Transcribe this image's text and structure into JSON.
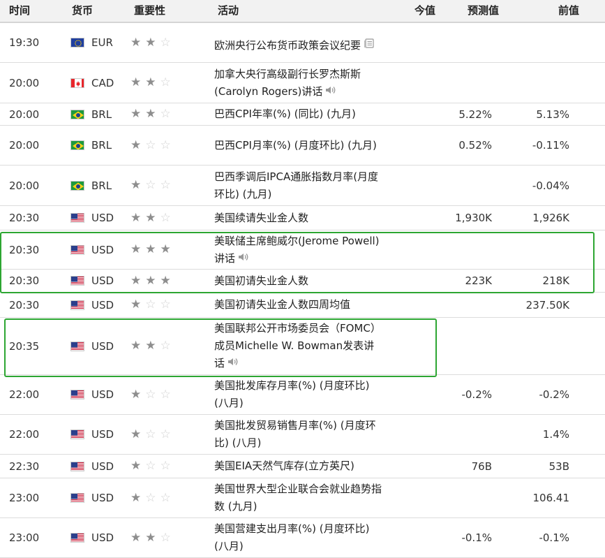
{
  "header": {
    "time": "时间",
    "currency": "货币",
    "importance": "重要性",
    "event": "活动",
    "actual": "今值",
    "forecast": "预测值",
    "previous": "前值"
  },
  "rows": [
    {
      "time": "19:30",
      "currency": "EUR",
      "flag": "eu",
      "stars": 2,
      "event": "欧洲央行公布货币政策会议纪要",
      "icon": "document-icon",
      "actual": "",
      "forecast": "",
      "previous": ""
    },
    {
      "time": "20:00",
      "currency": "CAD",
      "flag": "ca",
      "stars": 2,
      "event": "加拿大央行高级副行长罗杰斯斯(Carolyn Rogers)讲话",
      "icon": "speaker-icon",
      "actual": "",
      "forecast": "",
      "previous": ""
    },
    {
      "time": "20:00",
      "currency": "BRL",
      "flag": "br",
      "stars": 2,
      "event": "巴西CPI年率(%) (同比) (九月)",
      "icon": "",
      "actual": "",
      "forecast": "5.22%",
      "previous": "5.13%"
    },
    {
      "time": "20:00",
      "currency": "BRL",
      "flag": "br",
      "stars": 1,
      "event": "巴西CPI月率(%) (月度环比) (九月)",
      "icon": "",
      "actual": "",
      "forecast": "0.52%",
      "previous": "-0.11%"
    },
    {
      "time": "20:00",
      "currency": "BRL",
      "flag": "br",
      "stars": 1,
      "event": "巴西季调后IPCA通胀指数月率(月度环比) (九月)",
      "icon": "",
      "actual": "",
      "forecast": "",
      "previous": "-0.04%"
    },
    {
      "time": "20:30",
      "currency": "USD",
      "flag": "us",
      "stars": 2,
      "event": "美国续请失业金人数",
      "icon": "",
      "actual": "",
      "forecast": "1,930K",
      "previous": "1,926K"
    },
    {
      "time": "20:30",
      "currency": "USD",
      "flag": "us",
      "stars": 3,
      "event": "美联储主席鲍威尔(Jerome Powell)讲话",
      "icon": "speaker-icon",
      "actual": "",
      "forecast": "",
      "previous": ""
    },
    {
      "time": "20:30",
      "currency": "USD",
      "flag": "us",
      "stars": 3,
      "event": "美国初请失业金人数",
      "icon": "",
      "actual": "",
      "forecast": "223K",
      "previous": "218K"
    },
    {
      "time": "20:30",
      "currency": "USD",
      "flag": "us",
      "stars": 1,
      "event": "美国初请失业金人数四周均值",
      "icon": "",
      "actual": "",
      "forecast": "",
      "previous": "237.50K"
    },
    {
      "time": "20:35",
      "currency": "USD",
      "flag": "us",
      "stars": 2,
      "event": "美国联邦公开市场委员会（FOMC）成员Michelle W. Bowman发表讲话",
      "icon": "speaker-icon",
      "actual": "",
      "forecast": "",
      "previous": ""
    },
    {
      "time": "22:00",
      "currency": "USD",
      "flag": "us",
      "stars": 1,
      "event": "美国批发库存月率(%) (月度环比) (八月)",
      "icon": "",
      "actual": "",
      "forecast": "-0.2%",
      "previous": "-0.2%"
    },
    {
      "time": "22:00",
      "currency": "USD",
      "flag": "us",
      "stars": 1,
      "event": "美国批发贸易销售月率(%) (月度环比) (八月)",
      "icon": "",
      "actual": "",
      "forecast": "",
      "previous": "1.4%"
    },
    {
      "time": "22:30",
      "currency": "USD",
      "flag": "us",
      "stars": 1,
      "event": "美国EIA天然气库存(立方英尺)",
      "icon": "",
      "actual": "",
      "forecast": "76B",
      "previous": "53B"
    },
    {
      "time": "23:00",
      "currency": "USD",
      "flag": "us",
      "stars": 1,
      "event": "美国世界大型企业联合会就业趋势指数 (九月)",
      "icon": "",
      "actual": "",
      "forecast": "",
      "previous": "106.41"
    },
    {
      "time": "23:00",
      "currency": "USD",
      "flag": "us",
      "stars": 2,
      "event": "美国营建支出月率(%) (月度环比) (八月)",
      "icon": "",
      "actual": "",
      "forecast": "-0.1%",
      "previous": "-0.1%"
    }
  ],
  "colors": {
    "highlight": "#2da632",
    "star_on": "#8e8e8e",
    "star_off": "#d0d0d0",
    "header_bg": "#f2f2f2"
  }
}
